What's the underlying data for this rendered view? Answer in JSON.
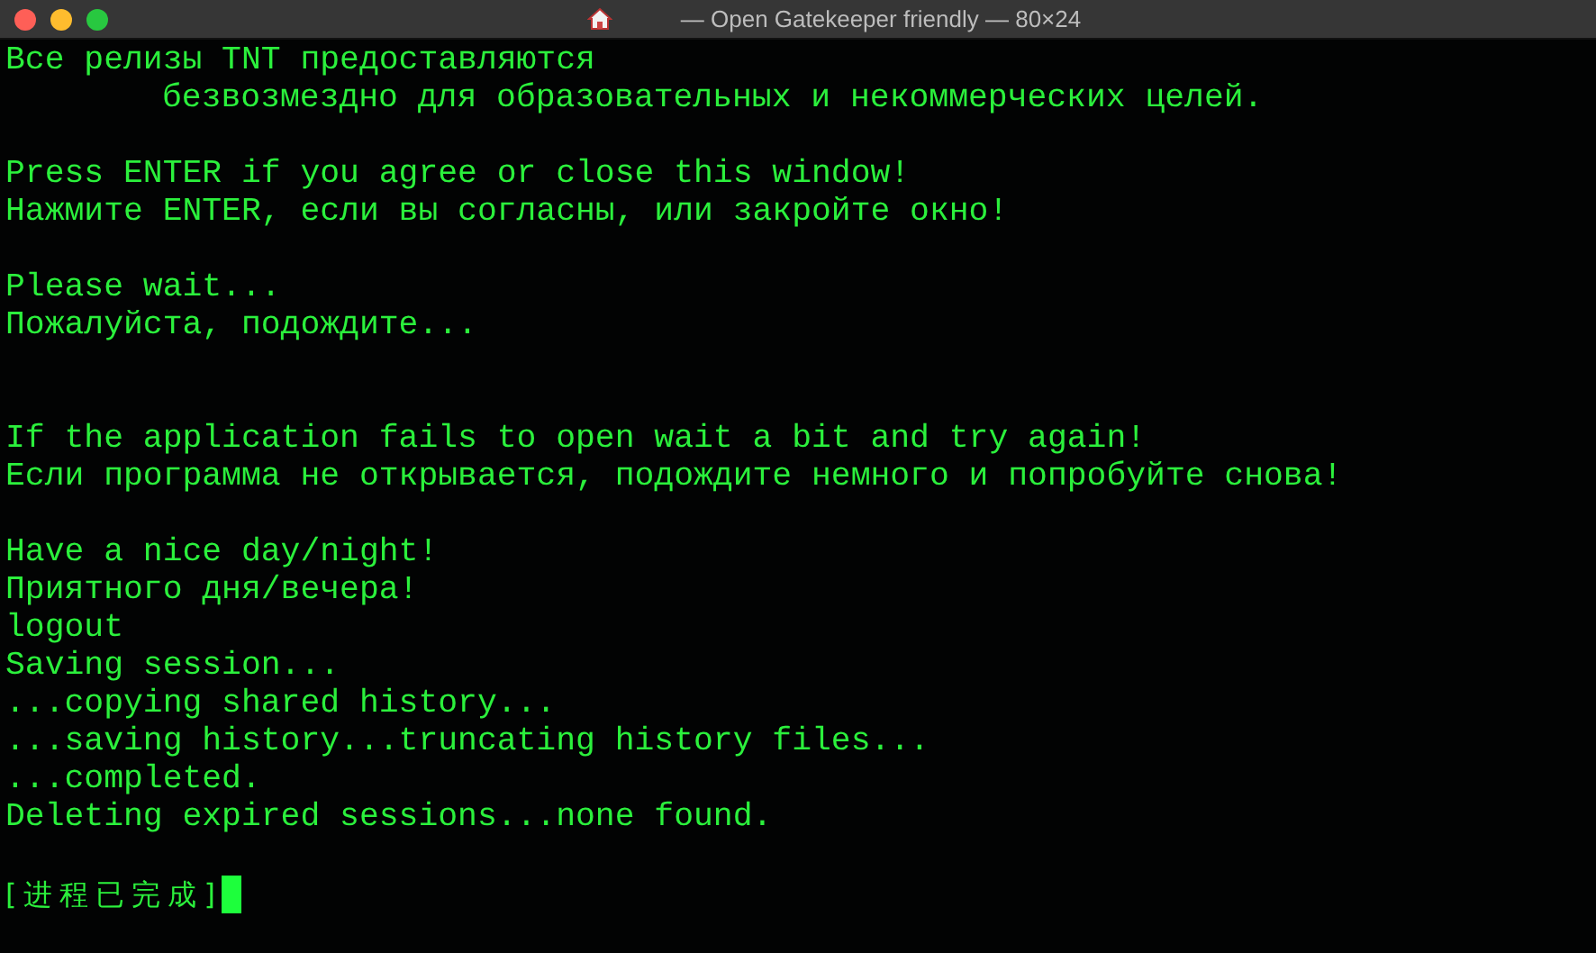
{
  "window": {
    "title": "— Open Gatekeeper friendly — 80×24"
  },
  "terminal": {
    "lines": [
      {
        "kind": "text",
        "text": "Все релизы TNT предоставляются"
      },
      {
        "kind": "indented",
        "text": "безвозмездно для образовательных и некоммерческих целей."
      },
      {
        "kind": "blank"
      },
      {
        "kind": "text",
        "text": "Press ENTER if you agree or close this window!"
      },
      {
        "kind": "text",
        "text": "Нажмите ENTER, если вы согласны, или закройте окно!"
      },
      {
        "kind": "blank"
      },
      {
        "kind": "text",
        "text": "Please wait..."
      },
      {
        "kind": "text",
        "text": "Пожалуйста, подождите..."
      },
      {
        "kind": "blank"
      },
      {
        "kind": "blank"
      },
      {
        "kind": "text",
        "text": "If the application fails to open wait a bit and try again!"
      },
      {
        "kind": "text",
        "text": "Если программа не открывается, подождите немного и попробуйте снова!"
      },
      {
        "kind": "blank"
      },
      {
        "kind": "text",
        "text": "Have a nice day/night!"
      },
      {
        "kind": "text",
        "text": "Приятного дня/вечера!"
      },
      {
        "kind": "text",
        "text": "logout"
      },
      {
        "kind": "text",
        "text": "Saving session..."
      },
      {
        "kind": "text",
        "text": "...copying shared history..."
      },
      {
        "kind": "text",
        "text": "...saving history...truncating history files..."
      },
      {
        "kind": "text",
        "text": "...completed."
      },
      {
        "kind": "text",
        "text": "Deleting expired sessions...none found."
      },
      {
        "kind": "blank"
      }
    ],
    "prompt": {
      "text": "[进程已完成]",
      "cursor": true
    }
  }
}
